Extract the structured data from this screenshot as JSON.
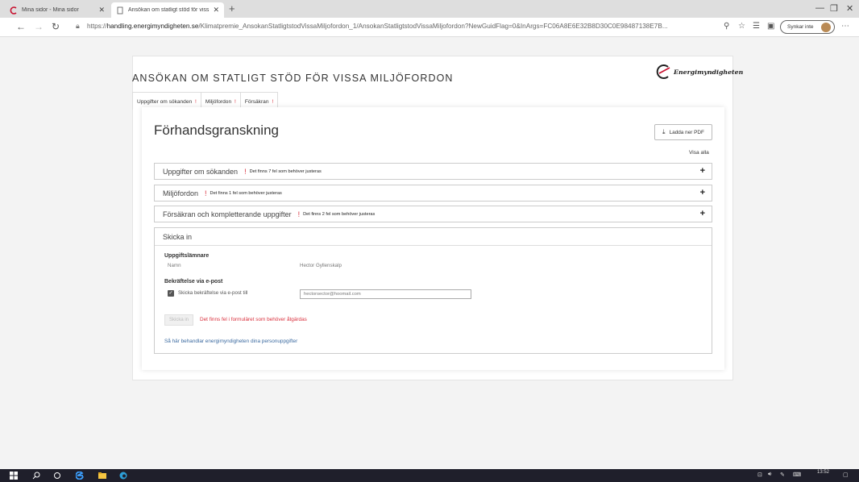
{
  "browser": {
    "tabs": [
      {
        "label": "Mina sidor - Mina sidor",
        "active": false
      },
      {
        "label": "Ansökan om statligt stöd för viss",
        "active": true
      }
    ],
    "url_host": "handling.energimyndigheten.se",
    "url_prefix": "https://",
    "url_path": "/Klimatpremie_AnsokanStatligtstodVissaMiljofordon_1/AnsokanStatligtstodVissaMiljofordon?NewGuidFlag=0&InArgs=FC06A8E6E32B8D30C0E98487138E7B...",
    "sync_label": "Synkar inte"
  },
  "page": {
    "heading": "ANSÖKAN OM STATLIGT STÖD FÖR VISSA MILJÖFORDON",
    "logo_text": "Energimyndigheten",
    "tabs": [
      {
        "label": "Uppgifter om sökanden",
        "mark": "!"
      },
      {
        "label": "Miljöfordon",
        "mark": "!"
      },
      {
        "label": "Försäkran",
        "mark": "!"
      }
    ],
    "title": "Förhandsgranskning",
    "pdf_button": "Ladda ner PDF",
    "show_all": "Visa alla",
    "sections": [
      {
        "title": "Uppgifter om sökanden",
        "mark": "!",
        "message": "Det finns 7 fel som behöver justeras"
      },
      {
        "title": "Miljöfordon",
        "mark": "!",
        "message": "Det finns 1 fel som behöver justeras"
      },
      {
        "title": "Försäkran och kompletterande uppgifter",
        "mark": "!",
        "message": "Det finns 2 fel som behöver justeras"
      }
    ],
    "submit": {
      "heading": "Skicka in",
      "provider_heading": "Uppgiftslämnare",
      "name_label": "Namn",
      "name_value": "Hector Gyllenskalp",
      "confirm_heading": "Bekräftelse via e-post",
      "confirm_checkbox_label": "Skicka bekräftelse via e-post till",
      "email_value": "hectorsector@hoomail.com",
      "send_button": "Skicka in",
      "error_message": "Det finns fel i formuläret som behöver åtgärdas",
      "privacy_link": "Så här behandlar energimyndigheten dina personuppgifter"
    }
  },
  "taskbar": {
    "time": "13:52"
  },
  "colors": {
    "error": "#d9303d",
    "link": "#3b6aa0",
    "taskbar": "#1f1f2b"
  }
}
